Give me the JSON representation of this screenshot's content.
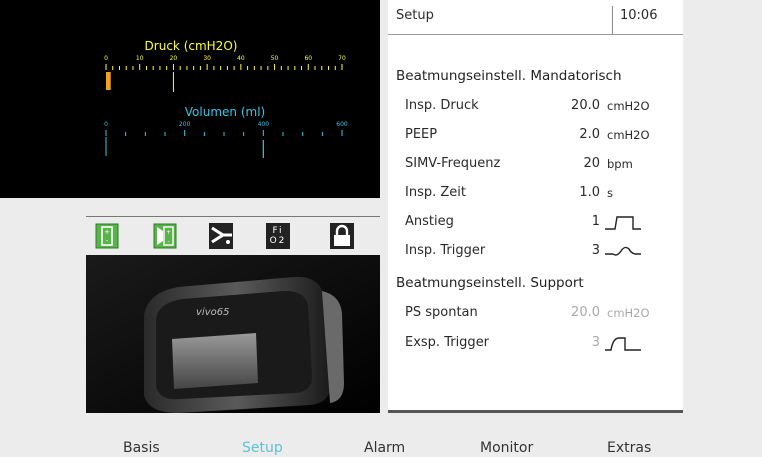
{
  "gauges": {
    "pressure": {
      "title": "Druck (cmH2O)",
      "ticks": [
        "0",
        "10",
        "20",
        "30",
        "40",
        "50",
        "60",
        "70"
      ],
      "bar_value": 1,
      "color": "#ffff33",
      "bar_color": "#f0a020"
    },
    "volume": {
      "title": "Volumen (ml)",
      "ticks": [
        "0",
        "200",
        "400",
        "600"
      ],
      "marker_value": 400,
      "color": "#33c8e8"
    }
  },
  "status_icons": [
    "battery-internal-icon",
    "battery-click-in-icon",
    "patient-circuit-icon",
    "fio2-icon",
    "lock-icon"
  ],
  "fio2_text": "Fi O2",
  "device_brand": "vivo65",
  "header": {
    "title": "Setup",
    "time": "10:06"
  },
  "mandatory": {
    "title": "Beatmungseinstell. Mandatorisch",
    "rows": [
      {
        "label": "Insp. Druck",
        "value": "20.0",
        "unit": "cmH2O"
      },
      {
        "label": "PEEP",
        "value": "2.0",
        "unit": "cmH2O"
      },
      {
        "label": "SIMV-Frequenz",
        "value": "20",
        "unit": "bpm"
      },
      {
        "label": "Insp. Zeit",
        "value": "1.0",
        "unit": "s"
      },
      {
        "label": "Anstieg",
        "value": "1",
        "unit": "",
        "icon": "rise-waveform-icon"
      },
      {
        "label": "Insp. Trigger",
        "value": "3",
        "unit": "",
        "icon": "trigger-waveform-icon"
      }
    ]
  },
  "support": {
    "title": "Beatmungseinstell. Support",
    "rows": [
      {
        "label": "PS spontan",
        "value": "20.0",
        "unit": "cmH2O"
      },
      {
        "label": "Exsp. Trigger",
        "value": "3",
        "unit": "",
        "icon": "exp-trigger-waveform-icon"
      }
    ]
  },
  "nav": {
    "items": [
      "Basis",
      "Setup",
      "Alarm",
      "Monitor",
      "Extras"
    ],
    "active": "Setup",
    "active_color": "#58c3d6"
  }
}
